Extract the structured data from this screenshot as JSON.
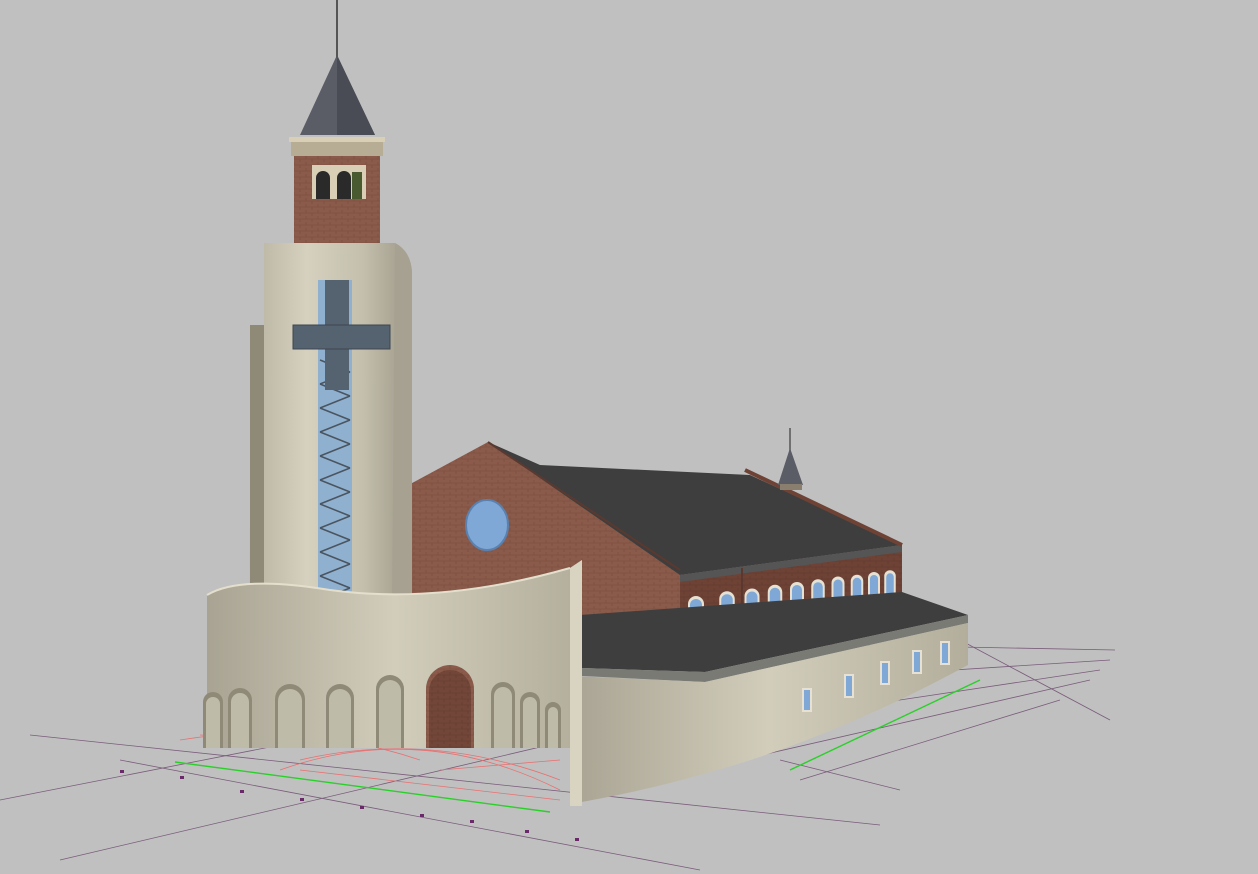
{
  "viewport": {
    "background": "#c0c0c0",
    "colors": {
      "brick": "#8a5a4a",
      "brick_dark": "#6e4336",
      "stone": "#c9c4b2",
      "stone_dark": "#a9a593",
      "roof": "#3e3e3e",
      "spire": "#5a5c66",
      "glass": "#7fa8d6",
      "window_frame": "#e6e1d2",
      "grid_line": "#7a5c7a",
      "ground_red": "#e87070",
      "ground_green": "#28d028",
      "ground_orange": "#e8c040"
    },
    "icons": {
      "rose_window": "rose-window-icon",
      "cross": "cross-icon"
    }
  }
}
